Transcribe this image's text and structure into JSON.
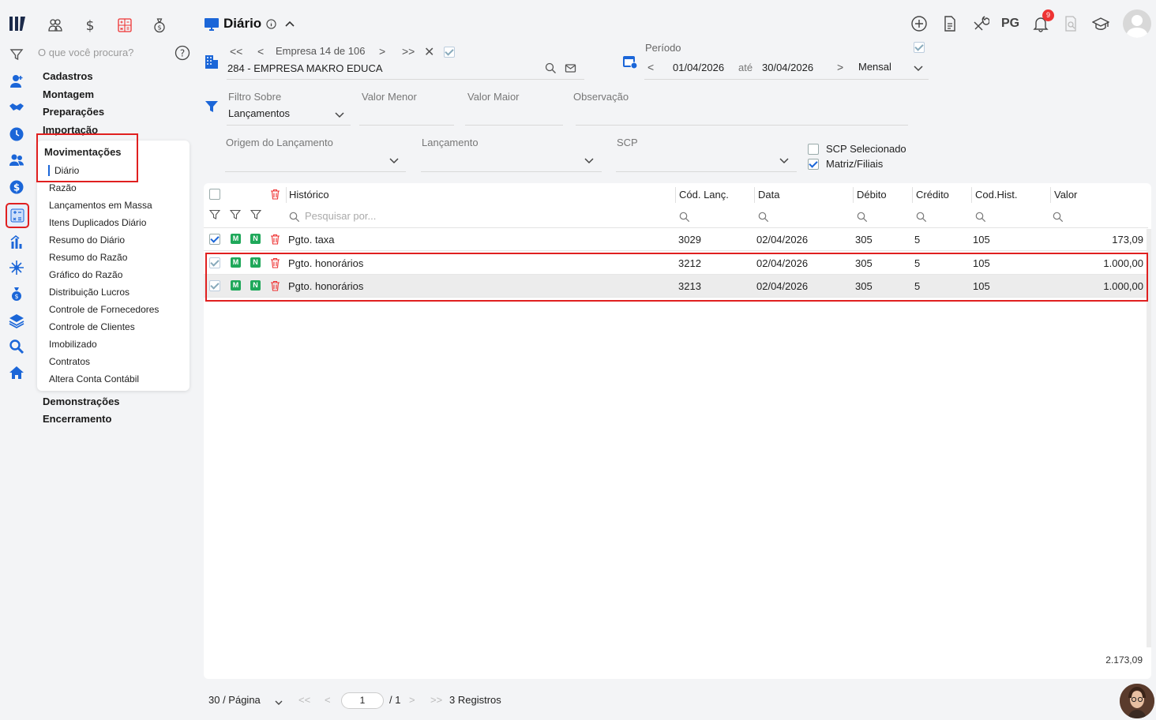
{
  "header": {
    "title": "Diário",
    "pg_label": "PG",
    "notifications_count": "9"
  },
  "search": {
    "placeholder": "O que você procura?"
  },
  "menu": {
    "groups_top": [
      "Cadastros",
      "Montagem",
      "Preparações",
      "Importação"
    ],
    "submenu_title": "Movimentações",
    "submenu_items": [
      "Diário",
      "Razão",
      "Lançamentos em Massa",
      "Itens Duplicados Diário",
      "Resumo do Diário",
      "Resumo do Razão",
      "Gráfico do Razão",
      "Distribuição Lucros",
      "Controle de Fornecedores",
      "Controle de Clientes",
      "Imobilizado",
      "Contratos",
      "Altera Conta Contábil"
    ],
    "groups_bottom": [
      "Demonstrações",
      "Encerramento"
    ]
  },
  "empresa": {
    "nav_label": "Empresa 14 de 106",
    "value": "284 - EMPRESA MAKRO EDUCA"
  },
  "periodo": {
    "label": "Período",
    "start": "01/04/2026",
    "separator": "até",
    "end": "30/04/2026",
    "mode": "Mensal"
  },
  "filters": {
    "filtro_sobre_label": "Filtro Sobre",
    "filtro_sobre_value": "Lançamentos",
    "valor_menor_label": "Valor Menor",
    "valor_maior_label": "Valor Maior",
    "observacao_label": "Observação",
    "origem_label": "Origem do Lançamento",
    "lancamento_label": "Lançamento",
    "scp_label": "SCP",
    "scp_selecionado_label": "SCP Selecionado",
    "matriz_filiais_label": "Matriz/Filiais"
  },
  "table": {
    "columns": [
      "Histórico",
      "Cód. Lanç.",
      "Data",
      "Débito",
      "Crédito",
      "Cod.Hist.",
      "Valor"
    ],
    "search_placeholder": "Pesquisar por...",
    "badge_m": "M",
    "badge_n": "N",
    "rows": [
      {
        "historico": "Pgto. taxa",
        "cod_lanc": "3029",
        "data": "02/04/2026",
        "debito": "305",
        "credito": "5",
        "cod_hist": "105",
        "valor": "173,09"
      },
      {
        "historico": "Pgto. honorários",
        "cod_lanc": "3212",
        "data": "02/04/2026",
        "debito": "305",
        "credito": "5",
        "cod_hist": "105",
        "valor": "1.000,00"
      },
      {
        "historico": "Pgto. honorários",
        "cod_lanc": "3213",
        "data": "02/04/2026",
        "debito": "305",
        "credito": "5",
        "cod_hist": "105",
        "valor": "1.000,00"
      }
    ],
    "total": "2.173,09"
  },
  "pagination": {
    "per_page": "30 / Página",
    "current_page": "1",
    "total_pages": "/ 1",
    "records": "3 Registros"
  },
  "colors": {
    "accent": "#1b66d8",
    "highlight": "#e02020",
    "badge": "#1fa85a"
  }
}
